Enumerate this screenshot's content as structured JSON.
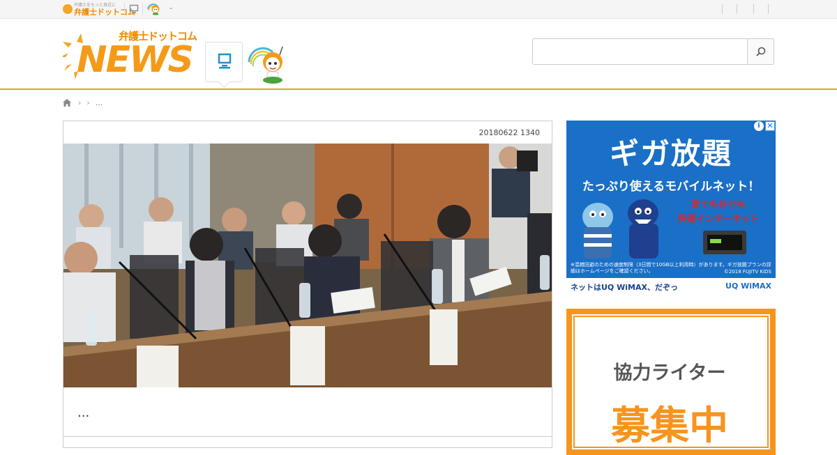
{
  "topbar": {
    "site_name": "弁護士ドットコム",
    "site_tagline": "弁護士をもっと身近に",
    "dash": "-"
  },
  "header": {
    "logo_kana": "弁護士ドットコム",
    "logo_text": "NEWS",
    "search_placeholder": "",
    "icons": {
      "pc": "pc-icon",
      "mascot": "mascot-icon",
      "search": "search-icon",
      "home": "home-icon"
    }
  },
  "breadcrumb": {
    "current": "..."
  },
  "article": {
    "date": "20180622 1340",
    "title": "...",
    "photo_desc": "meeting-photo"
  },
  "sidebar": {
    "ad1": {
      "headline": "ギガ放題",
      "subhead": "たっぷり使えるモバイルネット！",
      "bubble_line1": "家でも外でも",
      "bubble_line2": "快適インターネット",
      "fine_print": "※混雑回避のための速度制限（3日間で10GB以上利用時）があります。ギガ放題プランの詳細はホームページをご確認ください。",
      "credit": "©2018 FUJITV KIDS",
      "footer_left": "ネットはUQ WiMAX、だぞっ",
      "footer_right": "UQ WiMAX",
      "info": "i",
      "close": "✕"
    },
    "ad2": {
      "line1": "協力ライター",
      "line2": "募集中"
    }
  },
  "colors": {
    "brand_orange": "#f59a18",
    "header_border": "#e4a41f",
    "ad_blue": "#1a6fc7",
    "ad2_orange": "#f7941d"
  }
}
